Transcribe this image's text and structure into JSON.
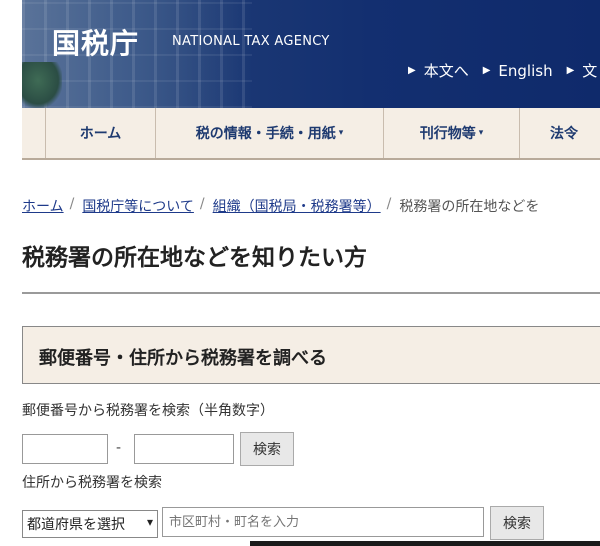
{
  "header": {
    "logo_kanji": "国税庁",
    "logo_en": "NATIONAL TAX AGENCY",
    "util_links": [
      "本文へ",
      "English",
      "文"
    ]
  },
  "nav": {
    "items": [
      {
        "label": "ホーム",
        "has_caret": false
      },
      {
        "label": "税の情報・手続・用紙",
        "has_caret": true
      },
      {
        "label": "刊行物等",
        "has_caret": true
      },
      {
        "label": "法令",
        "has_caret": false
      }
    ],
    "caret": "▾"
  },
  "breadcrumb": {
    "links": [
      "ホーム",
      "国税庁等について",
      "組織（国税局・税務署等）"
    ],
    "current": "税務署の所在地などを",
    "separator": "/"
  },
  "page": {
    "title": "税務署の所在地などを知りたい方"
  },
  "search": {
    "section_title": "郵便番号・住所から税務署を調べる",
    "postal_label": "郵便番号から税務署を検索（半角数字）",
    "postal_dash": "-",
    "postal_button": "検索",
    "address_label": "住所から税務署を検索",
    "prefecture_select": "都道府県を選択",
    "city_placeholder": "市区町村・町名を入力",
    "address_button": "検索"
  },
  "colors": {
    "header_bg": "#132f70",
    "nav_bg": "#f5eee5",
    "nav_text": "#1e3a70",
    "link": "#1e3a8a"
  },
  "icons": {
    "util_link_marker": "triangle-right-icon",
    "select_chevron": "chevron-down-icon"
  }
}
